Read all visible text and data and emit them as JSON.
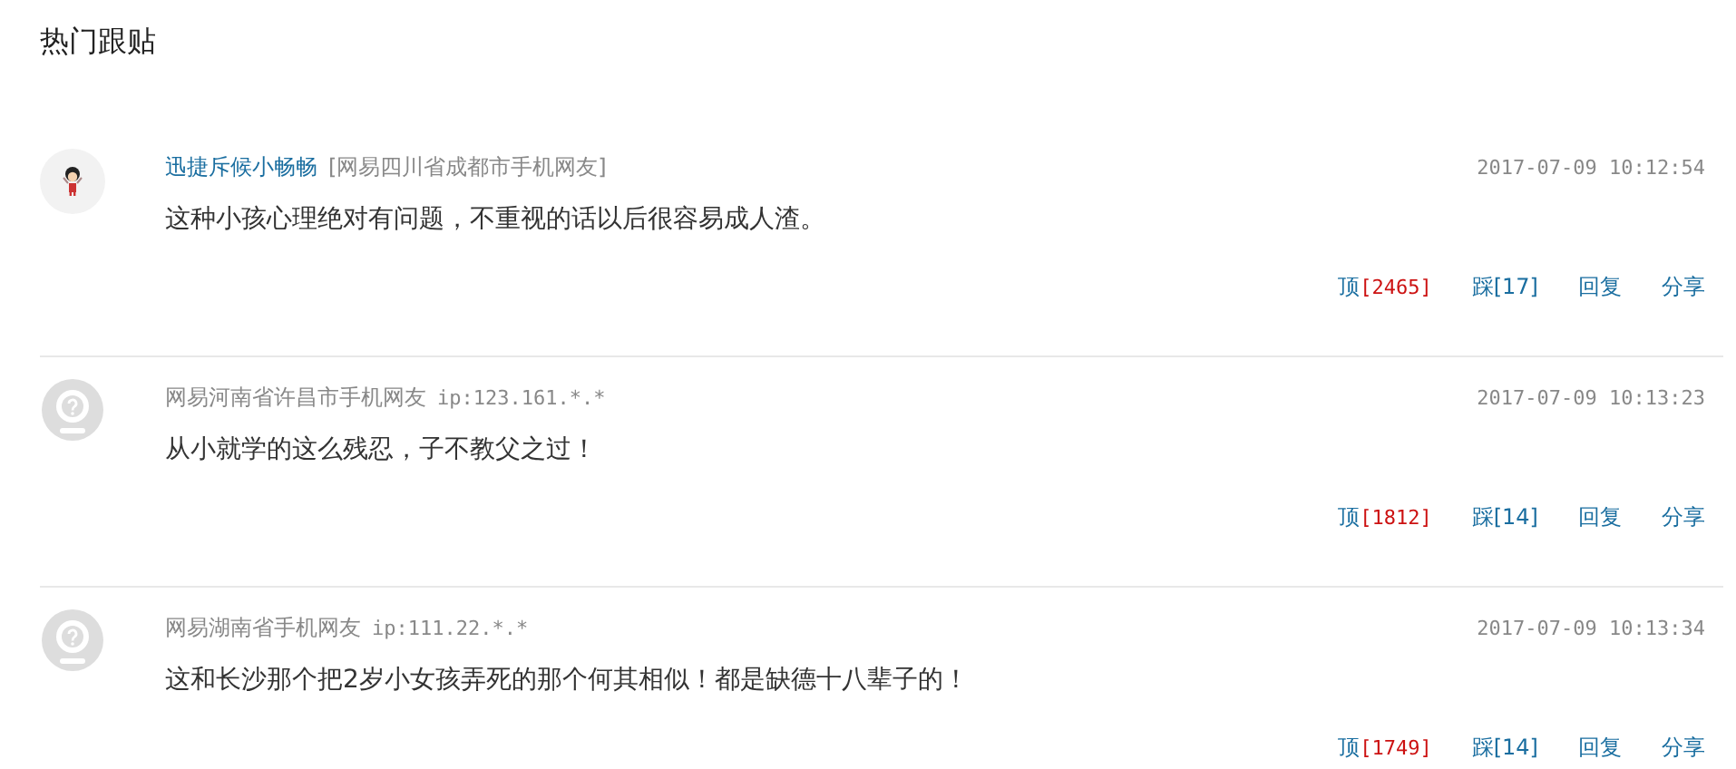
{
  "title": "热门跟贴",
  "comments": [
    {
      "avatar": {
        "kind": "cartoon"
      },
      "username": "迅捷斥候小畅畅",
      "location": "[网易四川省成都市手机网友]",
      "time": "2017-07-09 10:12:54",
      "body": "这种小孩心理绝对有问题，不重视的话以后很容易成人渣。",
      "up_label": "顶",
      "up_count": "[2465]",
      "down": "踩[17]",
      "reply": "回复",
      "share": "分享"
    },
    {
      "avatar": {
        "kind": "anonymous"
      },
      "location": "网易河南省许昌市手机网友",
      "ip": "ip:123.161.*.*",
      "time": "2017-07-09 10:13:23",
      "body": "从小就学的这么残忍，子不教父之过！",
      "up_label": "顶",
      "up_count": "[1812]",
      "down": "踩[14]",
      "reply": "回复",
      "share": "分享"
    },
    {
      "avatar": {
        "kind": "anonymous"
      },
      "location": "网易湖南省手机网友",
      "ip": "ip:111.22.*.*",
      "time": "2017-07-09 10:13:34",
      "body": "这和长沙那个把2岁小女孩弄死的那个何其相似！都是缺德十八辈子的！",
      "up_label": "顶",
      "up_count": "[1749]",
      "down": "踩[14]",
      "reply": "回复",
      "share": "分享"
    }
  ]
}
